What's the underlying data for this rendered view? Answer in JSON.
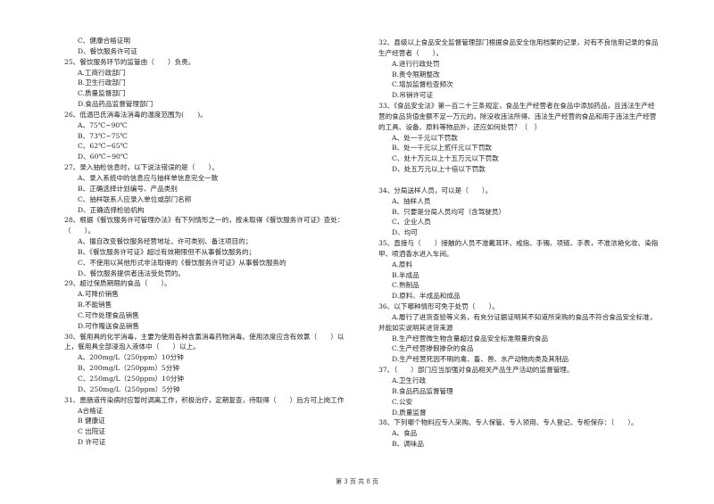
{
  "left_column": [
    {
      "t": "C、健康合格证明",
      "k": "opt"
    },
    {
      "t": "D、餐饮服务许可证",
      "k": "opt"
    },
    {
      "t": "25、餐饮服务环节的监管由（　　）负责。",
      "k": "q"
    },
    {
      "t": "A.工商行政部门",
      "k": "opt"
    },
    {
      "t": "B.卫生行政部门",
      "k": "opt"
    },
    {
      "t": "C.质量监督部门",
      "k": "opt"
    },
    {
      "t": "D.食品药品监督管理部门",
      "k": "opt"
    },
    {
      "t": "26、低温巴氏消毒法消毒的温度范围为(　　)。",
      "k": "q"
    },
    {
      "t": "A、75℃~90℃",
      "k": "opt"
    },
    {
      "t": "B、73℃~75℃",
      "k": "opt"
    },
    {
      "t": "C、62℃~65℃",
      "k": "opt"
    },
    {
      "t": "D、60℃~90℃",
      "k": "opt"
    },
    {
      "t": "27、录入抽检信息时，以下说法错误的是（　　）。",
      "k": "q"
    },
    {
      "t": "A、录入系统中的信息应与抽样单信息完全一致",
      "k": "opt"
    },
    {
      "t": "B、正确选择计划编号、产品类别",
      "k": "opt"
    },
    {
      "t": "C、抽样联系人应录入单位或部门名称",
      "k": "opt"
    },
    {
      "t": "D、正确选择检验机构",
      "k": "opt"
    },
    {
      "t": "28、根据《餐饮服务许可管理办法》有下列情形之一的，按未取得《餐饮服务许可证》查处：",
      "k": "q"
    },
    {
      "t": "（　　）。",
      "k": "q"
    },
    {
      "t": "A、擅自改变餐饮服务经营地址、许可类别、备注项目的；",
      "k": "opt"
    },
    {
      "t": "B、《餐饮服务许可证》超过有效期限但不从事餐饮服务的；",
      "k": "opt"
    },
    {
      "t": "C、不使用以其他形式非法取得的《餐饮服务许可证》从事餐饮服务的",
      "k": "opt"
    },
    {
      "t": "D、餐饮服务提供者违法受处罚的。",
      "k": "opt"
    },
    {
      "t": "29、超过保质期限的食品（　　）。",
      "k": "q"
    },
    {
      "t": "A.可降价销售",
      "k": "opt"
    },
    {
      "t": "B.不能销售",
      "k": "opt"
    },
    {
      "t": "C.可作处理食品销售",
      "k": "opt"
    },
    {
      "t": "D.可作赠送食品销售",
      "k": "opt"
    },
    {
      "t": "30、餐用具的化学消毒，主要为使用各种含氯消毒药物消毒。使用浓度应含有效氯（　　）以",
      "k": "q"
    },
    {
      "t": "上，餐用具全部浸泡入液体中（　　）以上。",
      "k": "q"
    },
    {
      "t": "A、200mg/L（250ppm）10分钟",
      "k": "opt"
    },
    {
      "t": "B、200mg/L（250ppm）5分钟",
      "k": "opt"
    },
    {
      "t": "C、250mg/L（250ppm）10分钟",
      "k": "opt"
    },
    {
      "t": "D、250mg/L（250ppm）5分钟",
      "k": "opt"
    },
    {
      "t": "31、患肠道传染病时应暂时调离工作，积极治疗，定期复查，待取得（　　）后方可上岗工作",
      "k": "q"
    },
    {
      "t": "A合格证",
      "k": "opt"
    },
    {
      "t": "B 健康证",
      "k": "opt"
    },
    {
      "t": "C 出院证",
      "k": "opt"
    },
    {
      "t": "D 许可证",
      "k": "opt"
    }
  ],
  "right_column": [
    {
      "t": "32、县级以上食品安全监督管理部门根据食品安全信用档案的记录，对有不良信用记录的食品",
      "k": "q"
    },
    {
      "t": "生产经营者（　　）。",
      "k": "q"
    },
    {
      "t": "A.进行行政处罚",
      "k": "opt"
    },
    {
      "t": "B.责令限期整改",
      "k": "opt"
    },
    {
      "t": "C.增加监督检查频次",
      "k": "opt"
    },
    {
      "t": "D.吊销许可证",
      "k": "opt"
    },
    {
      "t": "33、《食品安全法》第一百二十三条规定，食品生产经营者在食品中添加药品，且违法生产经",
      "k": "q"
    },
    {
      "t": "营的食品货值金额不足一万元的，除没收违法所得、违法生产经营的食品和用于违法生产经营",
      "k": "q"
    },
    {
      "t": "的工具、设备、原料等物品外，还应如何处罚？（　）",
      "k": "q"
    },
    {
      "t": "A、处一千元以下罚款",
      "k": "opt"
    },
    {
      "t": "B、处一千元以上贰仟元以下罚款",
      "k": "opt"
    },
    {
      "t": "C、处十万元以上十五万元以下罚款",
      "k": "opt"
    },
    {
      "t": "D、处五万元以上十倍以下罚款",
      "k": "opt"
    },
    {
      "t": "",
      "k": "q"
    },
    {
      "t": "34、分局送样人员，可以是（　　）。",
      "k": "q"
    },
    {
      "t": "A、抽样人员",
      "k": "opt"
    },
    {
      "t": "B、只要是分局人员均可（含驾驶员）",
      "k": "opt"
    },
    {
      "t": "C、企业人员",
      "k": "opt"
    },
    {
      "t": "D、均可",
      "k": "opt"
    },
    {
      "t": "35、直接与（　　）接触的人员不准戴耳环、戒指、手镯、项链、手表，不准浓艳化妆、染指",
      "k": "q"
    },
    {
      "t": "甲、喷洒香水进入车间。",
      "k": "q"
    },
    {
      "t": "A.原料",
      "k": "opt"
    },
    {
      "t": "B.半成品",
      "k": "opt"
    },
    {
      "t": "C.熟制品",
      "k": "opt"
    },
    {
      "t": "D.原料、半成品和成品",
      "k": "opt"
    },
    {
      "t": "36、以下哪种情形可免于处罚（　　）。",
      "k": "q"
    },
    {
      "t": "A.履行了进货查验等义务，有充分证据证明其不知道所采购的食品不符合食品安全标准，",
      "k": "opt"
    },
    {
      "t": "并能如实说明其进货来源",
      "k": "q"
    },
    {
      "t": "B.生产经营微生物含量超过食品安全标准限量的食品",
      "k": "opt"
    },
    {
      "t": "C.生产经营掺假掺杂的食品",
      "k": "opt"
    },
    {
      "t": "D.生产经营死因不明的禽、畜、兽、水产动物肉类及其制品",
      "k": "opt"
    },
    {
      "t": "37、（　　）部门应当加强对食品相关产品生产活动的监督管理。",
      "k": "q"
    },
    {
      "t": "A.卫生行政",
      "k": "opt"
    },
    {
      "t": "B.食品药品监督管理",
      "k": "opt"
    },
    {
      "t": "C.公安",
      "k": "opt"
    },
    {
      "t": "D.质量监督",
      "k": "opt"
    },
    {
      "t": "38、下列哪个物料应专人采购、专人保管、专人领用、专人登记、专柜保存：（　　）。",
      "k": "q"
    },
    {
      "t": "A、食品",
      "k": "opt"
    },
    {
      "t": "B、调味品",
      "k": "opt"
    }
  ],
  "footer": {
    "page_label": "第 3 页 共 8 页"
  }
}
